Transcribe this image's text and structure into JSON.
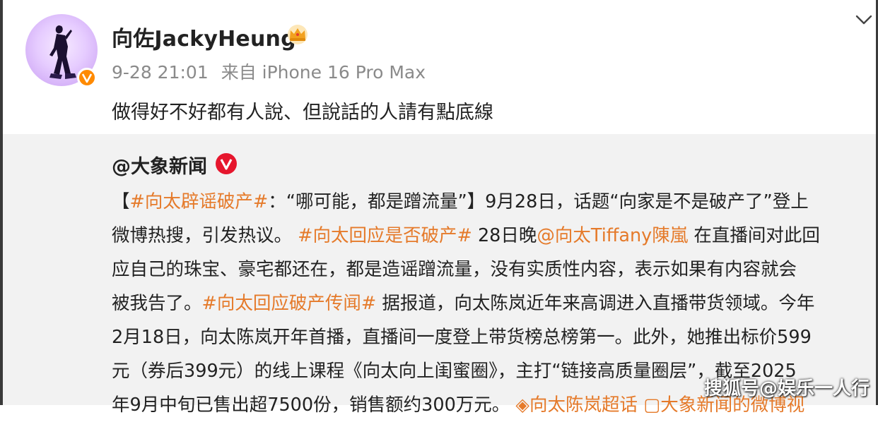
{
  "post": {
    "author": "向佐JackyHeung",
    "timestamp": "9-28 21:01",
    "source": "来自 iPhone 16 Pro Max",
    "text": "做得好不好都有人說、但說話的人請有點底線"
  },
  "repost": {
    "author": "@大象新闻",
    "lines": [
      [
        {
          "t": "【"
        },
        {
          "t": "#向太辟谣破产#",
          "tag": true
        },
        {
          "t": "：“哪可能，都是蹭流量”】9月28日，话题“向家是不是破产了”登上"
        }
      ],
      [
        {
          "t": "微博热搜，引发热议。 "
        },
        {
          "t": "#向太回应是否破产#",
          "tag": true
        },
        {
          "t": " 28日晚"
        },
        {
          "t": "@向太Tiffany陳嵐",
          "tag": true
        },
        {
          "t": " 在直播间对此回"
        }
      ],
      [
        {
          "t": "应自己的珠宝、豪宅都还在，都是造谣蹭流量，没有实质性内容，表示如果有内容就会"
        }
      ],
      [
        {
          "t": "被我告了。"
        },
        {
          "t": "#向太回应破产传闻#",
          "tag": true
        },
        {
          "t": " 据报道，向太陈岚近年来高调进入直播带货领域。今年"
        }
      ],
      [
        {
          "t": "2月18日，向太陈岚开年首播，直播间一度登上带货榜总榜第一。此外，她推出标价599"
        }
      ],
      [
        {
          "t": "元（券后399元）的线上课程《向太向上闺蜜圈》，主打“链接高质量圈层”，截至2025"
        }
      ],
      [
        {
          "t": "年9月中旬已售出超7500份，销售额约300万元。 "
        },
        {
          "t": "◈向太陈岚超话",
          "tag": true
        },
        {
          "t": " "
        },
        {
          "t": "▢大象新闻的微博视",
          "tag": true
        }
      ]
    ]
  },
  "watermark": "搜狐号@娱乐一人行",
  "icons": {
    "crown": "crown-icon",
    "verified_orange": "verified-badge-icon",
    "verified_red": "verified-red-icon",
    "chevron": "chevron-down-icon"
  },
  "colors": {
    "tag": "#e57a2a",
    "meta": "#8a8a8a",
    "repost_bg": "#f2f2f2",
    "verified_orange": "#ff8a00",
    "verified_red": "#e6162d"
  }
}
